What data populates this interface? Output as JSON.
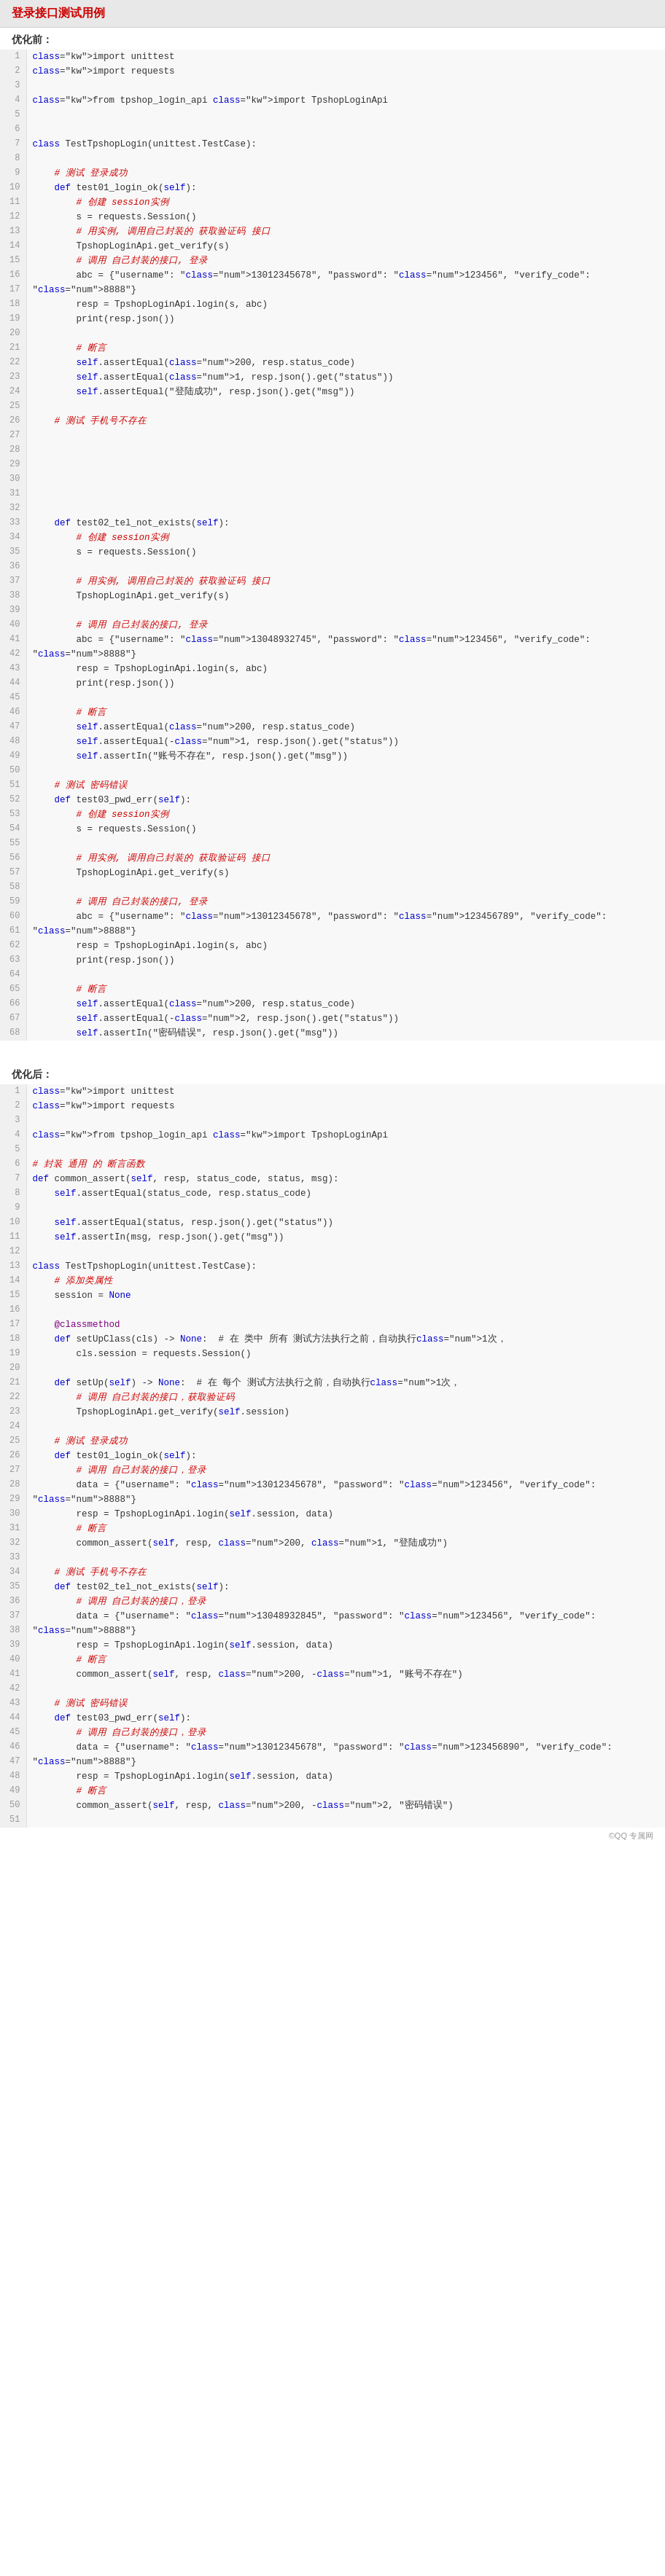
{
  "title": "登录接口测试用例",
  "before_label": "优化前：",
  "after_label": "优化后：",
  "watermark": "©QQ 专属网",
  "before_code": [
    {
      "n": 1,
      "code": "import unittest"
    },
    {
      "n": 2,
      "code": "import requests"
    },
    {
      "n": 3,
      "code": ""
    },
    {
      "n": 4,
      "code": "from tpshop_login_api import TpshopLoginApi"
    },
    {
      "n": 5,
      "code": ""
    },
    {
      "n": 6,
      "code": ""
    },
    {
      "n": 7,
      "code": "class TestTpshopLogin(unittest.TestCase):"
    },
    {
      "n": 8,
      "code": ""
    },
    {
      "n": 9,
      "code": "    # 测试 登录成功"
    },
    {
      "n": 10,
      "code": "    def test01_login_ok(self):"
    },
    {
      "n": 11,
      "code": "        # 创建 session实例"
    },
    {
      "n": 12,
      "code": "        s = requests.Session()"
    },
    {
      "n": 13,
      "code": "        # 用实例, 调用自己封装的 获取验证码 接口"
    },
    {
      "n": 14,
      "code": "        TpshopLoginApi.get_verify(s)"
    },
    {
      "n": 15,
      "code": "        # 调用 自己封装的接口, 登录"
    },
    {
      "n": 16,
      "code": "        abc = {\"username\": \"13012345678\", \"password\": \"123456\", \"verify_code\":"
    },
    {
      "n": 17,
      "code": "\"8888\"}"
    },
    {
      "n": 18,
      "code": "        resp = TpshopLoginApi.login(s, abc)"
    },
    {
      "n": 19,
      "code": "        print(resp.json())"
    },
    {
      "n": 20,
      "code": ""
    },
    {
      "n": 21,
      "code": "        # 断言"
    },
    {
      "n": 22,
      "code": "        self.assertEqual(200, resp.status_code)"
    },
    {
      "n": 23,
      "code": "        self.assertEqual(1, resp.json().get(\"status\"))"
    },
    {
      "n": 24,
      "code": "        self.assertEqual(\"登陆成功\", resp.json().get(\"msg\"))"
    },
    {
      "n": 25,
      "code": ""
    },
    {
      "n": 26,
      "code": "    # 测试 手机号不存在"
    },
    {
      "n": 27,
      "code": ""
    },
    {
      "n": 28,
      "code": ""
    },
    {
      "n": 29,
      "code": ""
    },
    {
      "n": 30,
      "code": ""
    },
    {
      "n": 31,
      "code": ""
    },
    {
      "n": 32,
      "code": ""
    },
    {
      "n": 33,
      "code": "    def test02_tel_not_exists(self):"
    },
    {
      "n": 34,
      "code": "        # 创建 session实例"
    },
    {
      "n": 35,
      "code": "        s = requests.Session()"
    },
    {
      "n": 36,
      "code": ""
    },
    {
      "n": 37,
      "code": "        # 用实例, 调用自己封装的 获取验证码 接口"
    },
    {
      "n": 38,
      "code": "        TpshopLoginApi.get_verify(s)"
    },
    {
      "n": 39,
      "code": ""
    },
    {
      "n": 40,
      "code": "        # 调用 自己封装的接口, 登录"
    },
    {
      "n": 41,
      "code": "        abc = {\"username\": \"13048932745\", \"password\": \"123456\", \"verify_code\":"
    },
    {
      "n": 42,
      "code": "\"8888\"}"
    },
    {
      "n": 43,
      "code": "        resp = TpshopLoginApi.login(s, abc)"
    },
    {
      "n": 44,
      "code": "        print(resp.json())"
    },
    {
      "n": 45,
      "code": ""
    },
    {
      "n": 46,
      "code": "        # 断言"
    },
    {
      "n": 47,
      "code": "        self.assertEqual(200, resp.status_code)"
    },
    {
      "n": 48,
      "code": "        self.assertEqual(-1, resp.json().get(\"status\"))"
    },
    {
      "n": 49,
      "code": "        self.assertIn(\"账号不存在\", resp.json().get(\"msg\"))"
    },
    {
      "n": 50,
      "code": ""
    },
    {
      "n": 51,
      "code": "    # 测试 密码错误"
    },
    {
      "n": 52,
      "code": "    def test03_pwd_err(self):"
    },
    {
      "n": 53,
      "code": "        # 创建 session实例"
    },
    {
      "n": 54,
      "code": "        s = requests.Session()"
    },
    {
      "n": 55,
      "code": ""
    },
    {
      "n": 56,
      "code": "        # 用实例, 调用自己封装的 获取验证码 接口"
    },
    {
      "n": 57,
      "code": "        TpshopLoginApi.get_verify(s)"
    },
    {
      "n": 58,
      "code": ""
    },
    {
      "n": 59,
      "code": "        # 调用 自己封装的接口, 登录"
    },
    {
      "n": 60,
      "code": "        abc = {\"username\": \"13012345678\", \"password\": \"123456789\", \"verify_code\":"
    },
    {
      "n": 61,
      "code": "\"8888\"}"
    },
    {
      "n": 62,
      "code": "        resp = TpshopLoginApi.login(s, abc)"
    },
    {
      "n": 63,
      "code": "        print(resp.json())"
    },
    {
      "n": 64,
      "code": ""
    },
    {
      "n": 65,
      "code": "        # 断言"
    },
    {
      "n": 66,
      "code": "        self.assertEqual(200, resp.status_code)"
    },
    {
      "n": 67,
      "code": "        self.assertEqual(-2, resp.json().get(\"status\"))"
    },
    {
      "n": 68,
      "code": "        self.assertIn(\"密码错误\", resp.json().get(\"msg\"))"
    }
  ],
  "after_code": [
    {
      "n": 1,
      "code": "import unittest"
    },
    {
      "n": 2,
      "code": "import requests"
    },
    {
      "n": 3,
      "code": ""
    },
    {
      "n": 4,
      "code": "from tpshop_login_api import TpshopLoginApi"
    },
    {
      "n": 5,
      "code": ""
    },
    {
      "n": 6,
      "code": "# 封装 通用 的 断言函数"
    },
    {
      "n": 7,
      "code": "def common_assert(self, resp, status_code, status, msg):"
    },
    {
      "n": 8,
      "code": "    self.assertEqual(status_code, resp.status_code)"
    },
    {
      "n": 9,
      "code": ""
    },
    {
      "n": 10,
      "code": "    self.assertEqual(status, resp.json().get(\"status\"))"
    },
    {
      "n": 11,
      "code": "    self.assertIn(msg, resp.json().get(\"msg\"))"
    },
    {
      "n": 12,
      "code": ""
    },
    {
      "n": 13,
      "code": "class TestTpshopLogin(unittest.TestCase):"
    },
    {
      "n": 14,
      "code": "    # 添加类属性"
    },
    {
      "n": 15,
      "code": "    session = None"
    },
    {
      "n": 16,
      "code": ""
    },
    {
      "n": 17,
      "code": "    @classmethod"
    },
    {
      "n": 18,
      "code": "    def setUpClass(cls) -> None:  # 在 类中 所有 测试方法执行之前，自动执行1次，"
    },
    {
      "n": 19,
      "code": "        cls.session = requests.Session()"
    },
    {
      "n": 20,
      "code": ""
    },
    {
      "n": 21,
      "code": "    def setUp(self) -> None:  # 在 每个 测试方法执行之前，自动执行1次，"
    },
    {
      "n": 22,
      "code": "        # 调用 自己封装的接口，获取验证码"
    },
    {
      "n": 23,
      "code": "        TpshopLoginApi.get_verify(self.session)"
    },
    {
      "n": 24,
      "code": ""
    },
    {
      "n": 25,
      "code": "    # 测试 登录成功"
    },
    {
      "n": 26,
      "code": "    def test01_login_ok(self):"
    },
    {
      "n": 27,
      "code": "        # 调用 自己封装的接口，登录"
    },
    {
      "n": 28,
      "code": "        data = {\"username\": \"13012345678\", \"password\": \"123456\", \"verify_code\":"
    },
    {
      "n": 29,
      "code": "\"8888\"}"
    },
    {
      "n": 30,
      "code": "        resp = TpshopLoginApi.login(self.session, data)"
    },
    {
      "n": 31,
      "code": "        # 断言"
    },
    {
      "n": 32,
      "code": "        common_assert(self, resp, 200, 1, \"登陆成功\")"
    },
    {
      "n": 33,
      "code": ""
    },
    {
      "n": 34,
      "code": "    # 测试 手机号不存在"
    },
    {
      "n": 35,
      "code": "    def test02_tel_not_exists(self):"
    },
    {
      "n": 36,
      "code": "        # 调用 自己封装的接口，登录"
    },
    {
      "n": 37,
      "code": "        data = {\"username\": \"13048932845\", \"password\": \"123456\", \"verify_code\":"
    },
    {
      "n": 38,
      "code": "\"8888\"}"
    },
    {
      "n": 39,
      "code": "        resp = TpshopLoginApi.login(self.session, data)"
    },
    {
      "n": 40,
      "code": "        # 断言"
    },
    {
      "n": 41,
      "code": "        common_assert(self, resp, 200, -1, \"账号不存在\")"
    },
    {
      "n": 42,
      "code": ""
    },
    {
      "n": 43,
      "code": "    # 测试 密码错误"
    },
    {
      "n": 44,
      "code": "    def test03_pwd_err(self):"
    },
    {
      "n": 45,
      "code": "        # 调用 自己封装的接口，登录"
    },
    {
      "n": 46,
      "code": "        data = {\"username\": \"13012345678\", \"password\": \"123456890\", \"verify_code\":"
    },
    {
      "n": 47,
      "code": "\"8888\"}"
    },
    {
      "n": 48,
      "code": "        resp = TpshopLoginApi.login(self.session, data)"
    },
    {
      "n": 49,
      "code": "        # 断言"
    },
    {
      "n": 50,
      "code": "        common_assert(self, resp, 200, -2, \"密码错误\")"
    },
    {
      "n": 51,
      "code": ""
    }
  ]
}
